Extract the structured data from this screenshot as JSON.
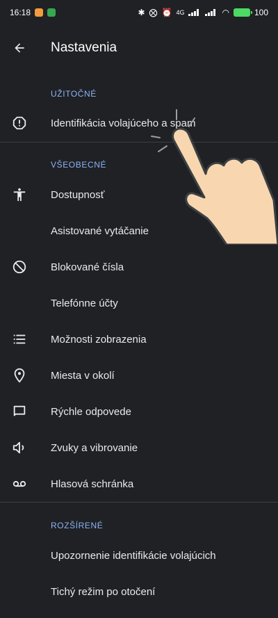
{
  "status_bar": {
    "time": "16:18",
    "network_badge": "4G",
    "battery_percent": "100"
  },
  "app_bar": {
    "title": "Nastavenia"
  },
  "sections": {
    "useful": {
      "header": "UŽITOČNÉ",
      "items": [
        {
          "label": "Identifikácia volajúceho a spam",
          "icon": "warning-circle-icon"
        }
      ]
    },
    "general": {
      "header": "VŠEOBECNÉ",
      "items": [
        {
          "label": "Dostupnosť",
          "icon": "accessibility-icon"
        },
        {
          "label": "Asistované vytáčanie",
          "icon": ""
        },
        {
          "label": "Blokované čísla",
          "icon": "block-icon"
        },
        {
          "label": "Telefónne účty",
          "icon": ""
        },
        {
          "label": "Možnosti zobrazenia",
          "icon": "list-icon"
        },
        {
          "label": "Miesta v okolí",
          "icon": "location-pin-icon"
        },
        {
          "label": "Rýchle odpovede",
          "icon": "chat-bubble-icon"
        },
        {
          "label": "Zvuky a vibrovanie",
          "icon": "speaker-icon"
        },
        {
          "label": "Hlasová schránka",
          "icon": "voicemail-icon"
        }
      ]
    },
    "advanced": {
      "header": "ROZŠÍRENÉ",
      "items": [
        {
          "label": "Upozornenie identifikácie volajúcich"
        },
        {
          "label": "Tichý režim po otočení"
        }
      ]
    }
  },
  "colors": {
    "background": "#202124",
    "accent": "#8ab4f8",
    "text": "#e8eaed",
    "divider": "#3c4043"
  }
}
